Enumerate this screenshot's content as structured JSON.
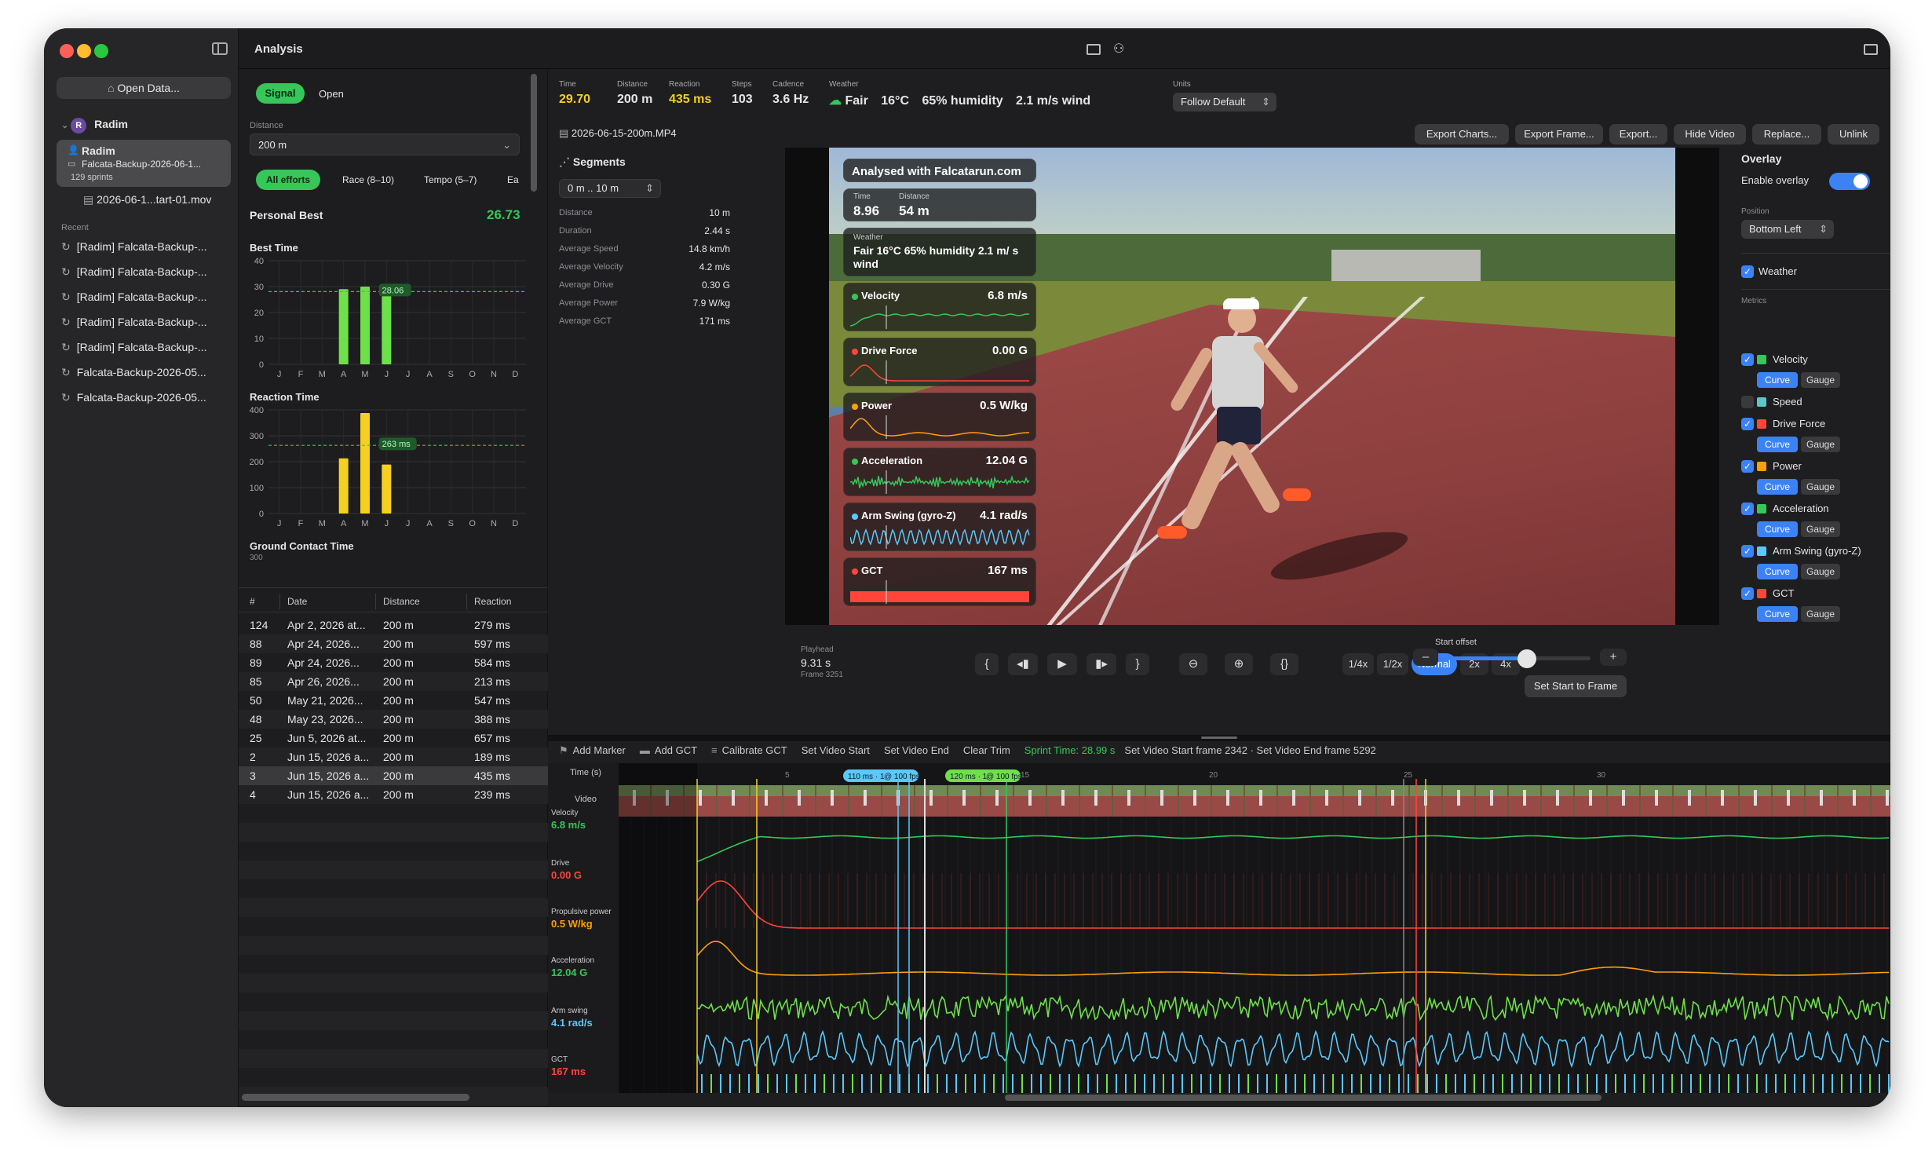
{
  "window": {
    "title": "Analysis",
    "colors": {
      "accent": "#35c759",
      "blue": "#3b82f6",
      "yellow": "#f5d020",
      "red": "#ff453a",
      "orange": "#ff9f0a"
    }
  },
  "sidebar": {
    "open_button": "Open Data...",
    "user": {
      "initial": "R",
      "name": "Radim"
    },
    "selected": {
      "name": "Radim",
      "file": "Falcata-Backup-2026-06-1...",
      "count": "129 sprints"
    },
    "video_file": "2026-06-1...tart-01.mov",
    "recent_label": "Recent",
    "recent": [
      "[Radim] Falcata-Backup-...",
      "[Radim] Falcata-Backup-...",
      "[Radim] Falcata-Backup-...",
      "[Radim] Falcata-Backup-...",
      "[Radim] Falcata-Backup-...",
      "Falcata-Backup-2026-05...",
      "Falcata-Backup-2026-05..."
    ]
  },
  "left_panel": {
    "tabs": {
      "signal": "Signal",
      "open": "Open"
    },
    "distance_label": "Distance",
    "distance_value": "200 m",
    "filters": [
      "All efforts",
      "Race (8–10)",
      "Tempo (5–7)",
      "Ea"
    ],
    "personal_best_label": "Personal Best",
    "personal_best_value": "26.73",
    "months": [
      "J",
      "F",
      "M",
      "A",
      "M",
      "J",
      "J",
      "A",
      "S",
      "O",
      "N",
      "D"
    ],
    "best_time": {
      "title": "Best Time",
      "yticks": [
        "40",
        "30",
        "20",
        "10",
        "0"
      ],
      "ylim": [
        0,
        40
      ],
      "values": [
        0,
        0,
        0,
        29,
        30,
        28,
        0,
        0,
        0,
        0,
        0,
        0
      ],
      "ref_value": 28.06,
      "ref_label": "28.06"
    },
    "reaction_time": {
      "title": "Reaction Time",
      "yticks": [
        "400",
        "300",
        "200",
        "100",
        "0"
      ],
      "ylim": [
        0,
        400
      ],
      "values": [
        0,
        0,
        0,
        213,
        388,
        189,
        0,
        0,
        0,
        0,
        0,
        0
      ],
      "ref_value": 263,
      "ref_label": "263 ms"
    },
    "gct_title": "Ground Contact Time",
    "gct_tick": "300",
    "table": {
      "headers": [
        "#",
        "Date",
        "Distance",
        "Reaction"
      ],
      "rows": [
        [
          "124",
          "Apr 2, 2026 at...",
          "200 m",
          "279 ms"
        ],
        [
          "88",
          "Apr 24, 2026...",
          "200 m",
          "597 ms"
        ],
        [
          "89",
          "Apr 24, 2026...",
          "200 m",
          "584 ms"
        ],
        [
          "85",
          "Apr 26, 2026...",
          "200 m",
          "213 ms"
        ],
        [
          "50",
          "May 21, 2026...",
          "200 m",
          "547 ms"
        ],
        [
          "48",
          "May 23, 2026...",
          "200 m",
          "388 ms"
        ],
        [
          "25",
          "Jun 5, 2026 at...",
          "200 m",
          "657 ms"
        ],
        [
          "2",
          "Jun 15, 2026 a...",
          "200 m",
          "189 ms"
        ],
        [
          "3",
          "Jun 15, 2026 a...",
          "200 m",
          "435 ms"
        ],
        [
          "4",
          "Jun 15, 2026 a...",
          "200 m",
          "239 ms"
        ]
      ]
    }
  },
  "stats": {
    "time_label": "Time",
    "time": "29.70",
    "distance_label": "Distance",
    "distance": "200 m",
    "reaction_label": "Reaction",
    "reaction": "435 ms",
    "steps_label": "Steps",
    "steps": "103",
    "cadence_label": "Cadence",
    "cadence": "3.6 Hz",
    "weather_label": "Weather",
    "weather": "Fair",
    "temp": "16°C",
    "humidity": "65% humidity",
    "wind": "2.1 m/s wind",
    "units_label": "Units",
    "units": "Follow Default"
  },
  "video_file": "2026-06-15-200m.MP4",
  "actions": [
    "Export Charts...",
    "Export Frame...",
    "Export...",
    "Hide Video",
    "Replace...",
    "Unlink"
  ],
  "segments": {
    "title": "Segments",
    "range": "0 m .. 10 m",
    "rows": [
      [
        "Distance",
        "10 m"
      ],
      [
        "Duration",
        "2.44 s"
      ],
      [
        "Average Speed",
        "14.8 km/h"
      ],
      [
        "Average Velocity",
        "4.2 m/s"
      ],
      [
        "Average Drive",
        "0.30 G"
      ],
      [
        "Average Power",
        "7.9 W/kg"
      ],
      [
        "Average GCT",
        "171 ms"
      ]
    ]
  },
  "overlay_cards": {
    "brand": "Analysed with Falcatarun.com",
    "time_label": "Time",
    "time": "8.96",
    "distance_label": "Distance",
    "distance": "54 m",
    "weather_label": "Weather",
    "weather": "Fair 16°C 65% humidity 2.1 m/ s wind",
    "metrics": [
      {
        "label": "Velocity",
        "value": "6.8 m/s",
        "color": "#35c759"
      },
      {
        "label": "Drive Force",
        "value": "0.00 G",
        "color": "#ff453a"
      },
      {
        "label": "Power",
        "value": "0.5 W/kg",
        "color": "#ff9f0a"
      },
      {
        "label": "Acceleration",
        "value": "12.04 G",
        "color": "#35c759"
      },
      {
        "label": "Arm Swing (gyro-Z)",
        "value": "4.1 rad/s",
        "color": "#5ac8fa"
      },
      {
        "label": "GCT",
        "value": "167 ms",
        "color": "#ff453a"
      }
    ]
  },
  "overlay_panel": {
    "title": "Overlay",
    "enable_label": "Enable overlay",
    "position_label": "Position",
    "position": "Bottom Left",
    "weather_label": "Weather",
    "metrics_label": "Metrics",
    "curve": "Curve",
    "gauge": "Gauge",
    "metrics": [
      {
        "label": "Velocity",
        "color": "#35c759",
        "checked": true
      },
      {
        "label": "Speed",
        "color": "#5ac8c8",
        "checked": false
      },
      {
        "label": "Drive Force",
        "color": "#ff453a",
        "checked": true
      },
      {
        "label": "Power",
        "color": "#ff9f0a",
        "checked": true
      },
      {
        "label": "Acceleration",
        "color": "#35c759",
        "checked": true
      },
      {
        "label": "Arm Swing (gyro-Z)",
        "color": "#5ac8fa",
        "checked": true
      },
      {
        "label": "GCT",
        "color": "#ff453a",
        "checked": true
      }
    ]
  },
  "playback": {
    "playhead_label": "Playhead",
    "playhead": "9.31 s",
    "frame": "Frame 3251",
    "speeds": [
      "1/4x",
      "1/2x",
      "Normal",
      "2x",
      "4x"
    ],
    "start_offset_label": "Start offset",
    "start_offset_fraction": 0.55,
    "set_start": "Set Start to Frame",
    "minus": "–",
    "plus": "+"
  },
  "timeline": {
    "toolbar": [
      "Add Marker",
      "Add GCT",
      "Calibrate GCT",
      "Set Video Start",
      "Set Video End",
      "Clear Trim"
    ],
    "sprint_time": "Sprint Time: 28.99 s",
    "frame_info": "Set Video Start frame 2342 · Set Video End frame 5292",
    "time_label": "Time (s)",
    "video_label": "Video",
    "ticks": [
      "5",
      "15",
      "20",
      "25",
      "30"
    ],
    "chip1": "110 ms · 1",
    "chip1b": "@ 100 fps",
    "chip2": "120 ms · 1",
    "chip2b": "@ 100 fps",
    "tracks": [
      {
        "label": "Velocity",
        "value": "6.8 m/s",
        "color": "#35c759"
      },
      {
        "label": "Drive",
        "value": "0.00 G",
        "color": "#ff453a"
      },
      {
        "label": "Propulsive power",
        "value": "0.5 W/kg",
        "color": "#ff9f0a"
      },
      {
        "label": "Acceleration",
        "value": "12.04 G",
        "color": "#35c759"
      },
      {
        "label": "Arm swing",
        "value": "4.1 rad/s",
        "color": "#5ac8fa"
      },
      {
        "label": "GCT",
        "value": "167 ms",
        "color": "#ff453a"
      }
    ]
  }
}
